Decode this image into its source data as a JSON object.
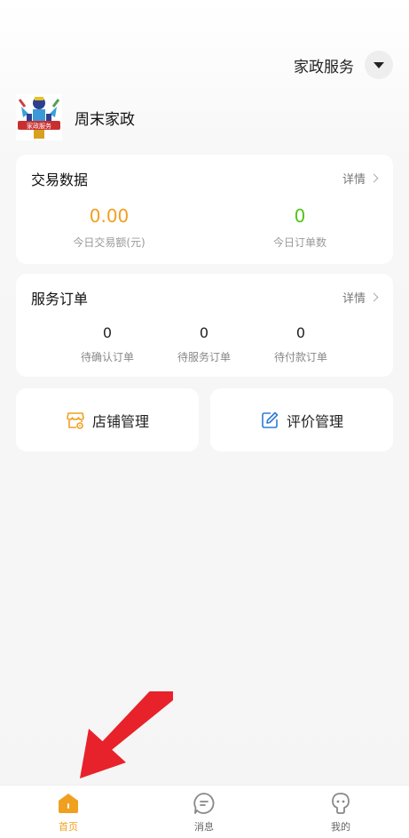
{
  "header": {
    "service_label": "家政服务"
  },
  "store": {
    "name": "周末家政",
    "logo_text": "家政服务"
  },
  "trade_card": {
    "title": "交易数据",
    "more": "详情",
    "stats": [
      {
        "value": "0.00",
        "label": "今日交易额(元)",
        "color": "#f0a020"
      },
      {
        "value": "0",
        "label": "今日订单数",
        "color": "#52c41a"
      }
    ]
  },
  "order_card": {
    "title": "服务订单",
    "more": "详情",
    "stats": [
      {
        "value": "0",
        "label": "待确认订单"
      },
      {
        "value": "0",
        "label": "待服务订单"
      },
      {
        "value": "0",
        "label": "待付款订单"
      }
    ]
  },
  "actions": {
    "store_manage": "店铺管理",
    "review_manage": "评价管理"
  },
  "tabbar": {
    "items": [
      {
        "label": "首页",
        "icon": "home-icon",
        "active": true
      },
      {
        "label": "消息",
        "icon": "message-icon",
        "active": false
      },
      {
        "label": "我的",
        "icon": "profile-icon",
        "active": false
      }
    ],
    "active_color": "#f0a020"
  }
}
